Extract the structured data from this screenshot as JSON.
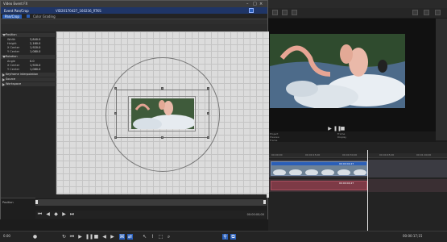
{
  "fx_window": {
    "title": "Video Event FX",
    "header_path": "Event Pan/Crop",
    "header_file": "VID20170427_160236_RTKS",
    "tab_label": "Pan/Crop",
    "tab2_label": "Color Grading",
    "properties": {
      "position": {
        "label": "Position",
        "rows": [
          {
            "label": "Width",
            "value": "3,840.0"
          },
          {
            "label": "Height",
            "value": "2,160.0"
          },
          {
            "label": "X Center",
            "value": "1,920.0"
          },
          {
            "label": "Y Center",
            "value": "1,080.0"
          }
        ]
      },
      "rotation": {
        "label": "Rotation",
        "rows": [
          {
            "label": "Angle",
            "value": "0.0"
          },
          {
            "label": "X Center",
            "value": "1,920.0"
          },
          {
            "label": "Y Center",
            "value": "1,080.0"
          }
        ]
      },
      "sections": [
        "Keyframe interpolation",
        "Source",
        "Workspace"
      ]
    },
    "position_label": "Position",
    "timecode": "00:00:00;00"
  },
  "preview": {
    "info_left": [
      "Project",
      "Preview",
      "Frame"
    ],
    "info_right": [
      "Frame",
      "Display"
    ]
  },
  "timeline": {
    "clip_label": "00:00:04;27",
    "audio_clip_label": "00:00:04;27",
    "ruler_marks": [
      "00:00:00",
      "00:00:15;00",
      "00:00:30;00",
      "00:00:45;00",
      "00:01:00;00"
    ]
  },
  "transport": {
    "rate": "0.00",
    "timecode": "00:00:17;15"
  },
  "colors": {
    "accent_blue": "#2b5fb8",
    "clip_video": "#5a6d86",
    "clip_audio": "#7d3a46"
  }
}
